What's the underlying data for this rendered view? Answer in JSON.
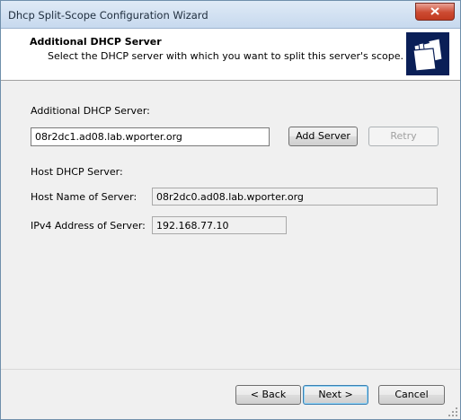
{
  "window": {
    "title": "Dhcp Split-Scope Configuration Wizard"
  },
  "header": {
    "title": "Additional DHCP Server",
    "subtitle": "Select the DHCP server with which you want to split this server's scope."
  },
  "additional": {
    "label": "Additional DHCP Server:",
    "value": "08r2dc1.ad08.lab.wporter.org",
    "add_label": "Add Server",
    "retry_label": "Retry"
  },
  "host": {
    "section_label": "Host DHCP Server:",
    "name_label": "Host Name of Server:",
    "name_value": "08r2dc0.ad08.lab.wporter.org",
    "ip_label": "IPv4 Address of Server:",
    "ip_value": "192.168.77.10"
  },
  "footer": {
    "back_label": "< Back",
    "next_label": "Next >",
    "cancel_label": "Cancel"
  },
  "icons": [
    "close-icon",
    "wizard-folders-icon",
    "resize-grip-icon"
  ],
  "colors": {
    "titlebar": "#c7d9ee",
    "close": "#cc4a31",
    "default_button_border": "#3c7fb1"
  }
}
